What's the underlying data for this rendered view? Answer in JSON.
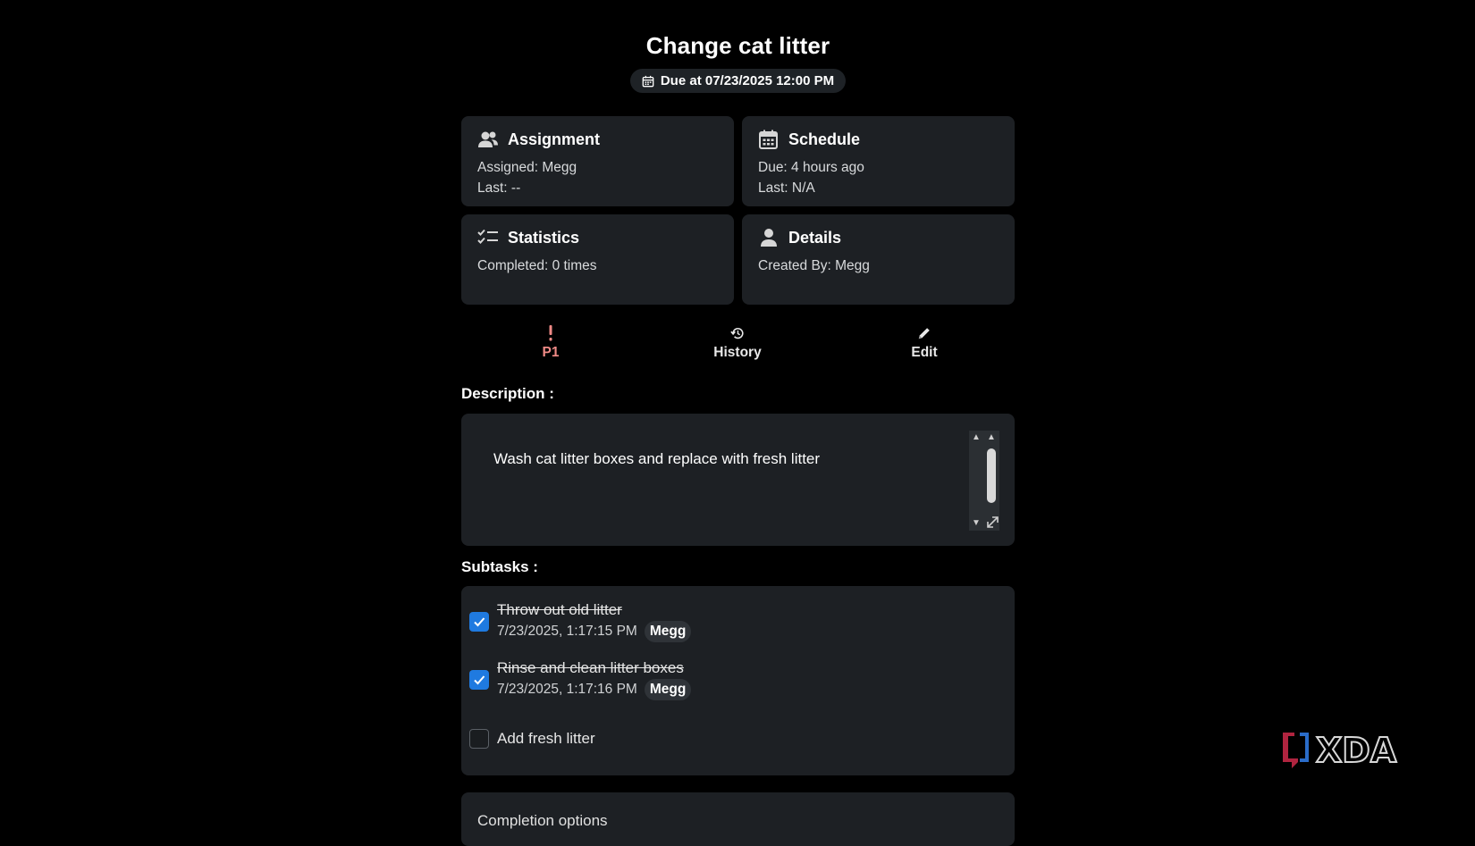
{
  "task": {
    "title": "Change cat litter",
    "due_label": "Due at 07/23/2025 12:00 PM"
  },
  "cards": {
    "assignment": {
      "title": "Assignment",
      "line1": "Assigned: Megg",
      "line2": "Last: --",
      "icon": "users-icon"
    },
    "schedule": {
      "title": "Schedule",
      "line1": "Due: 4 hours ago",
      "line2": "Last: N/A",
      "icon": "calendar-icon"
    },
    "statistics": {
      "title": "Statistics",
      "line1": "Completed: 0 times",
      "icon": "checklist-icon"
    },
    "details": {
      "title": "Details",
      "line1": "Created By: Megg",
      "icon": "person-icon"
    }
  },
  "actions": {
    "priority": {
      "label": "P1",
      "icon": "exclamation-icon",
      "color": "#ef8a86"
    },
    "history": {
      "label": "History",
      "icon": "history-icon"
    },
    "edit": {
      "label": "Edit",
      "icon": "pencil-icon"
    }
  },
  "description": {
    "label": "Description :",
    "text": "Wash cat litter boxes and replace with fresh litter"
  },
  "subtasks": {
    "label": "Subtasks :",
    "items": [
      {
        "title": "Throw out old litter",
        "done": true,
        "date": "7/23/2025, 1:17:15 PM",
        "user": "Megg"
      },
      {
        "title": "Rinse and clean litter boxes",
        "done": true,
        "date": "7/23/2025, 1:17:16 PM",
        "user": "Megg"
      },
      {
        "title": "Add fresh litter",
        "done": false
      }
    ]
  },
  "completion": {
    "label": "Completion options"
  },
  "watermark": {
    "text": "XDA"
  },
  "colors": {
    "accent": "#1f7ae0",
    "card_bg": "#1d2024",
    "page_bg": "#000000",
    "priority": "#ef8a86"
  }
}
